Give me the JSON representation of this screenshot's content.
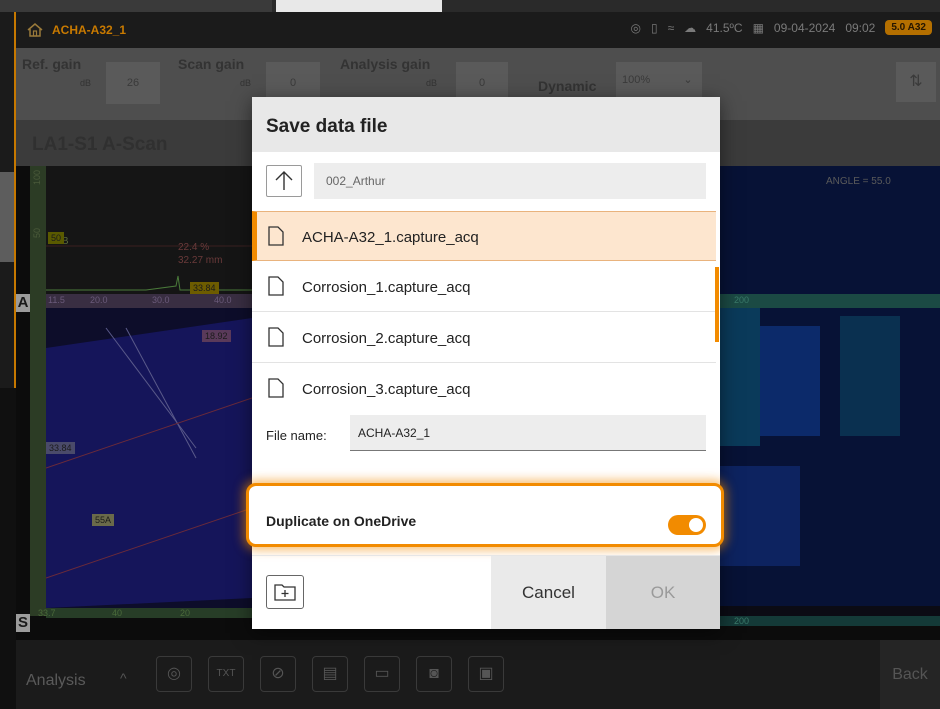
{
  "status_bar": {
    "title": "ACHA-A32_1",
    "temperature": "41.5ºC",
    "date": "09-04-2024",
    "time": "09:02",
    "version_badge": "5.0 A32"
  },
  "gain_bar": {
    "ref_gain_label": "Ref. gain",
    "ref_gain_value": "26",
    "ref_gain_unit": "dB",
    "scan_gain_label": "Scan gain",
    "scan_gain_value": "0",
    "scan_gain_unit": "dB",
    "analysis_gain_label": "Analysis gain",
    "analysis_gain_value": "0",
    "analysis_gain_unit": "dB",
    "dynamic_label": "Dynamic",
    "dynamic_value": "100%"
  },
  "scan_title": "LA1-S1 A-Scan",
  "plot": {
    "angle_text": "ANGLE = 55.0",
    "percent_readout": "22.4 %",
    "mm_readout": "32.27 mm",
    "zero_db": "0 dB",
    "readout_33": "33.84",
    "readout_18": "18.92",
    "readout_55": "55A",
    "axis_top": "100",
    "axis_mid": "50",
    "a_ticks": [
      "11.5",
      "20.0",
      "30.0",
      "40.0"
    ],
    "s_ticks": [
      "33.7",
      "40",
      "20"
    ],
    "right_tick": "200",
    "a_label": "A",
    "s_label": "S"
  },
  "bottom_bar": {
    "analysis_label": "Analysis",
    "back_label": "Back",
    "tools": [
      "analysis-icon",
      "txt-export-icon",
      "link-icon",
      "layout-icon",
      "clipboard-icon",
      "camera-icon",
      "save-icon"
    ]
  },
  "dialog": {
    "title": "Save data file",
    "current_path": "002_Arthur",
    "files": [
      {
        "name": "ACHA-A32_1.capture_acq",
        "selected": true
      },
      {
        "name": "Corrosion_1.capture_acq",
        "selected": false
      },
      {
        "name": "Corrosion_2.capture_acq",
        "selected": false
      },
      {
        "name": "Corrosion_3.capture_acq",
        "selected": false
      }
    ],
    "file_name_label": "File name:",
    "file_name_value": "ACHA-A32_1",
    "onedrive_label": "Duplicate on OneDrive",
    "onedrive_enabled": true,
    "cancel_label": "Cancel",
    "ok_label": "OK",
    "accent_color": "#f28b00"
  }
}
